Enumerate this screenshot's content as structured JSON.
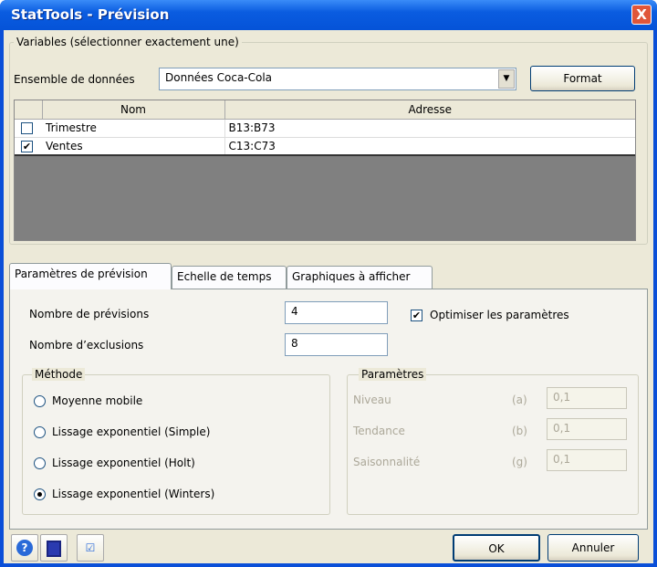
{
  "window": {
    "title": "StatTools - Prévision",
    "close": "X"
  },
  "variables": {
    "legend": "Variables (sélectionner exactement une)",
    "dataset_label": "Ensemble de données",
    "dataset_value": "Données Coca-Cola",
    "format_button": "Format",
    "columns": [
      "Nom",
      "Adresse"
    ],
    "rows": [
      {
        "checked": false,
        "name": "Trimestre",
        "address": "B13:B73"
      },
      {
        "checked": true,
        "name": "Ventes",
        "address": "C13:C73"
      }
    ]
  },
  "tabs": [
    "Paramètres de prévision",
    "Echelle de temps",
    "Graphiques à afficher"
  ],
  "forecast": {
    "num_forecasts_label": "Nombre de prévisions",
    "num_forecasts": "4",
    "num_holdouts_label": "Nombre d’exclusions",
    "num_holdouts": "8",
    "optimize_label": "Optimiser les paramètres",
    "optimize": true
  },
  "method": {
    "legend": "Méthode",
    "options": [
      "Moyenne mobile",
      "Lissage exponentiel (Simple)",
      "Lissage exponentiel (Holt)",
      "Lissage exponentiel (Winters)"
    ],
    "selected": 3
  },
  "params": {
    "legend": "Paramètres",
    "items": [
      {
        "label": "Niveau",
        "sym": "(a)",
        "value": "0,1"
      },
      {
        "label": "Tendance",
        "sym": "(b)",
        "value": "0,1"
      },
      {
        "label": "Saisonnalité",
        "sym": "(g)",
        "value": "0,1"
      }
    ]
  },
  "footer": {
    "ok": "OK",
    "cancel": "Annuler"
  }
}
